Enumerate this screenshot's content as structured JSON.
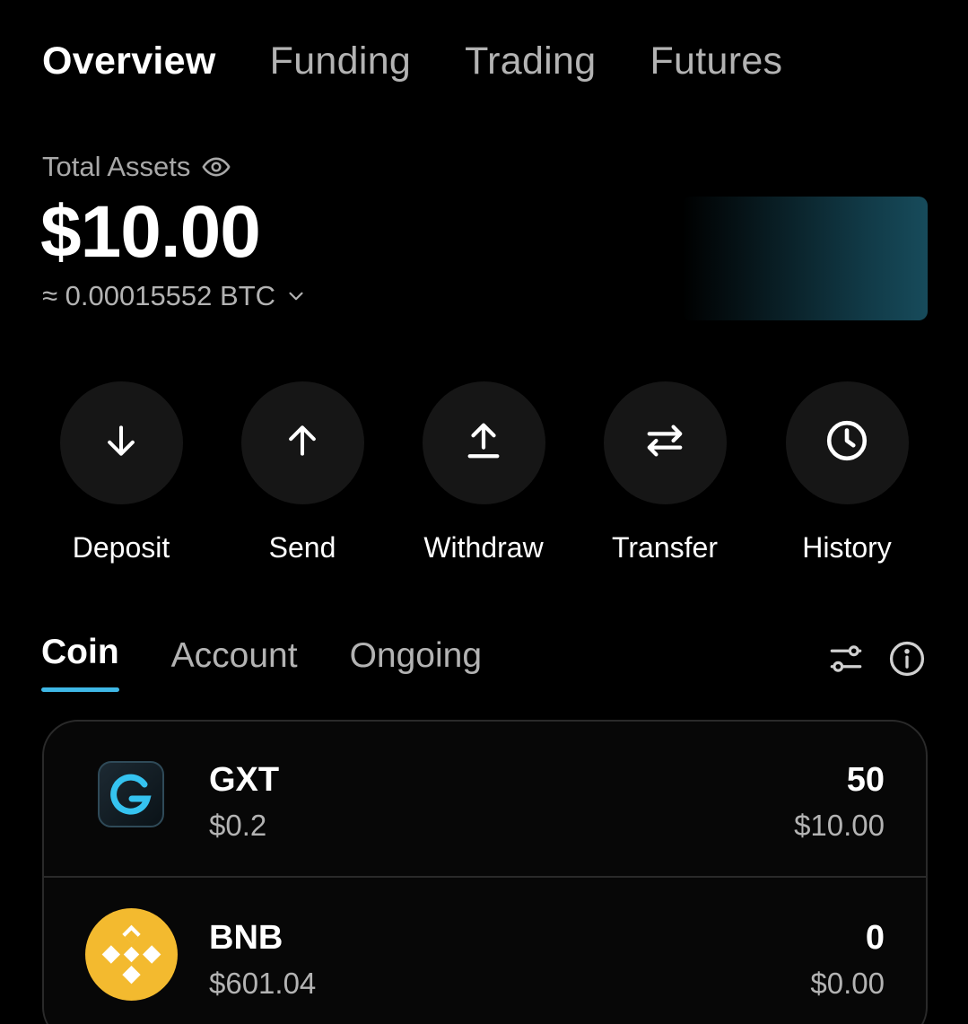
{
  "top_tabs": [
    {
      "label": "Overview",
      "active": true
    },
    {
      "label": "Funding",
      "active": false
    },
    {
      "label": "Trading",
      "active": false
    },
    {
      "label": "Futures",
      "active": false
    }
  ],
  "summary": {
    "label": "Total Assets",
    "balance": "$10.00",
    "btc_equivalent": "≈ 0.00015552 BTC"
  },
  "actions": [
    {
      "label": "Deposit",
      "icon": "arrow-down-icon"
    },
    {
      "label": "Send",
      "icon": "arrow-up-icon"
    },
    {
      "label": "Withdraw",
      "icon": "upload-icon"
    },
    {
      "label": "Transfer",
      "icon": "swap-arrows-icon"
    },
    {
      "label": "History",
      "icon": "clock-icon"
    }
  ],
  "asset_tabs": [
    {
      "label": "Coin",
      "active": true
    },
    {
      "label": "Account",
      "active": false
    },
    {
      "label": "Ongoing",
      "active": false
    }
  ],
  "coins": [
    {
      "symbol": "GXT",
      "price": "$0.2",
      "amount": "50",
      "value": "$10.00",
      "logo": "gxt-logo"
    },
    {
      "symbol": "BNB",
      "price": "$601.04",
      "amount": "0",
      "value": "$0.00",
      "logo": "bnb-logo"
    }
  ],
  "colors": {
    "background": "#000000",
    "accent": "#3fb8e6",
    "bnb_yellow": "#f3ba2f",
    "muted_text": "#b3b3b3"
  }
}
